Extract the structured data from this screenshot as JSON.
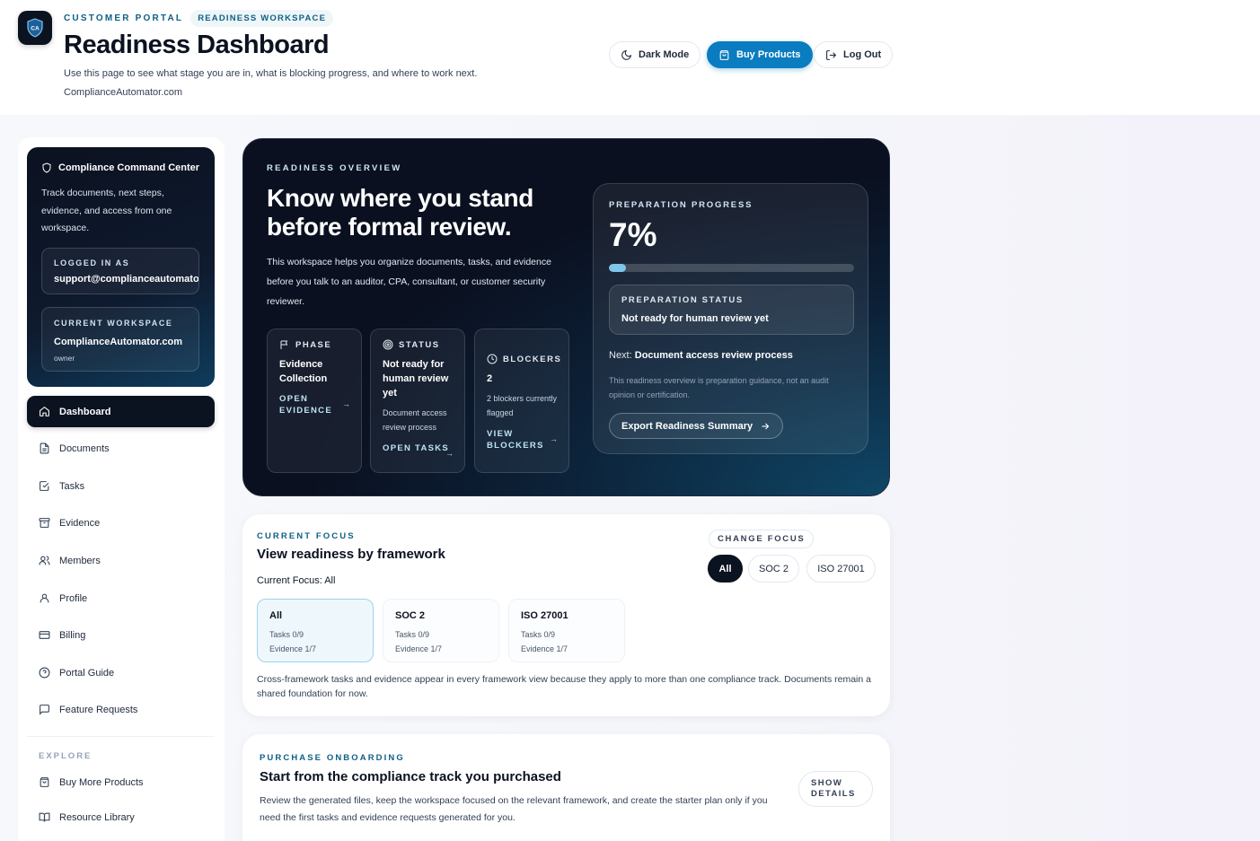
{
  "header": {
    "logo_text": "CA",
    "eyebrow": "CUSTOMER PORTAL",
    "tag": "READINESS WORKSPACE",
    "title": "Readiness Dashboard",
    "description": "Use this page to see what stage you are in, what is blocking progress, and where to work next.",
    "site": "ComplianceAutomator.com",
    "buttons": {
      "dark_mode": "Dark Mode",
      "buy_products": "Buy Products",
      "log_out": "Log Out"
    }
  },
  "sidebar": {
    "command_center": {
      "title": "Compliance Command Center",
      "description": "Track documents, next steps, evidence, and access from one workspace.",
      "logged_in_label": "LOGGED IN AS",
      "logged_in_value": "support@complianceautomator.com",
      "workspace_label": "CURRENT WORKSPACE",
      "workspace_value": "ComplianceAutomator.com",
      "workspace_role": "owner"
    },
    "nav": [
      {
        "label": "Dashboard",
        "icon": "home-icon"
      },
      {
        "label": "Documents",
        "icon": "document-icon"
      },
      {
        "label": "Tasks",
        "icon": "checkbox-icon"
      },
      {
        "label": "Evidence",
        "icon": "archive-icon"
      },
      {
        "label": "Members",
        "icon": "users-icon"
      },
      {
        "label": "Profile",
        "icon": "user-icon"
      },
      {
        "label": "Billing",
        "icon": "credit-card-icon"
      },
      {
        "label": "Portal Guide",
        "icon": "help-circle-icon"
      },
      {
        "label": "Feature Requests",
        "icon": "message-square-icon"
      }
    ],
    "explore_label": "EXPLORE",
    "explore": [
      {
        "label": "Buy More Products",
        "icon": "shopping-bag-icon"
      },
      {
        "label": "Resource Library",
        "icon": "book-open-icon"
      }
    ]
  },
  "hero": {
    "eyebrow": "READINESS OVERVIEW",
    "title": "Know where you stand before formal review.",
    "description": "This workspace helps you organize documents, tasks, and evidence before you talk to an auditor, CPA, consultant, or customer security reviewer.",
    "phase": {
      "label": "PHASE",
      "value": "Evidence Collection",
      "link": "OPEN EVIDENCE"
    },
    "status": {
      "label": "STATUS",
      "value": "Not ready for human review yet",
      "sub": "Document access review process",
      "link": "OPEN TASKS"
    },
    "blockers": {
      "label": "BLOCKERS",
      "value": "2",
      "sub": "2 blockers currently flagged",
      "link": "VIEW BLOCKERS"
    },
    "progress": {
      "label": "PREPARATION PROGRESS",
      "percent_text": "7%",
      "percent": 7,
      "status_label": "PREPARATION STATUS",
      "status_value": "Not ready for human review yet",
      "next_label": "Next:",
      "next_value": "Document access review process",
      "disclaimer": "This readiness overview is preparation guidance, not an audit opinion or certification.",
      "export_label": "Export Readiness Summary"
    }
  },
  "focus": {
    "eyebrow": "CURRENT FOCUS",
    "title": "View readiness by framework",
    "current": "Current Focus: All",
    "change_label": "CHANGE FOCUS",
    "chips": [
      "All",
      "SOC 2",
      "ISO 27001"
    ],
    "frameworks": [
      {
        "name": "All",
        "tasks": "Tasks 0/9",
        "evidence": "Evidence 1/7"
      },
      {
        "name": "SOC 2",
        "tasks": "Tasks 0/9",
        "evidence": "Evidence 1/7"
      },
      {
        "name": "ISO 27001",
        "tasks": "Tasks 0/9",
        "evidence": "Evidence 1/7"
      }
    ],
    "note": "Cross-framework tasks and evidence appear in every framework view because they apply to more than one compliance track. Documents remain a shared foundation for now."
  },
  "purchase": {
    "eyebrow": "PURCHASE ONBOARDING",
    "title": "Start from the compliance track you purchased",
    "description": "Review the generated files, keep the workspace focused on the relevant framework, and create the starter plan only if you need the first tasks and evidence requests generated for you.",
    "show_details": "SHOW DETAILS"
  },
  "colors": {
    "accent": "#0a7cc0",
    "eyebrow": "#0f5f86",
    "dark": "#0b1220",
    "progress_fill": "#7fc6ea"
  }
}
